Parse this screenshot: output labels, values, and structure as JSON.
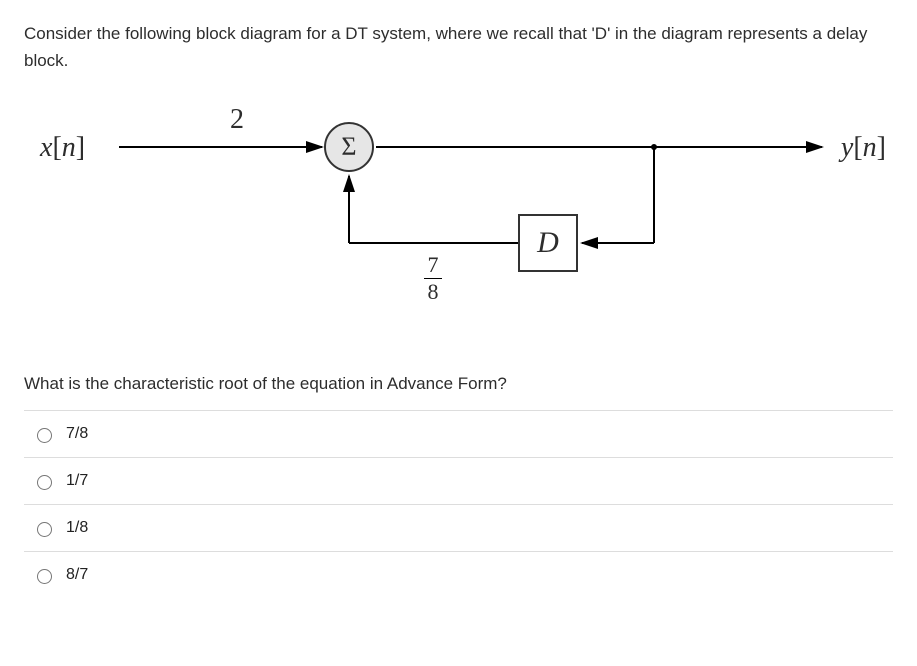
{
  "question": {
    "intro": "Consider the following block diagram for a DT system, where we recall that 'D' in the diagram represents a delay block.",
    "prompt": "What is the characteristic root of the equation in Advance Form?"
  },
  "diagram": {
    "input_label": "x[n]",
    "output_label": "y[n]",
    "forward_gain": "2",
    "sum_symbol": "Σ",
    "delay_symbol": "D",
    "feedback_gain_num": "7",
    "feedback_gain_den": "8"
  },
  "options": [
    {
      "label": "7/8"
    },
    {
      "label": "1/7"
    },
    {
      "label": "1/8"
    },
    {
      "label": "8/7"
    }
  ]
}
